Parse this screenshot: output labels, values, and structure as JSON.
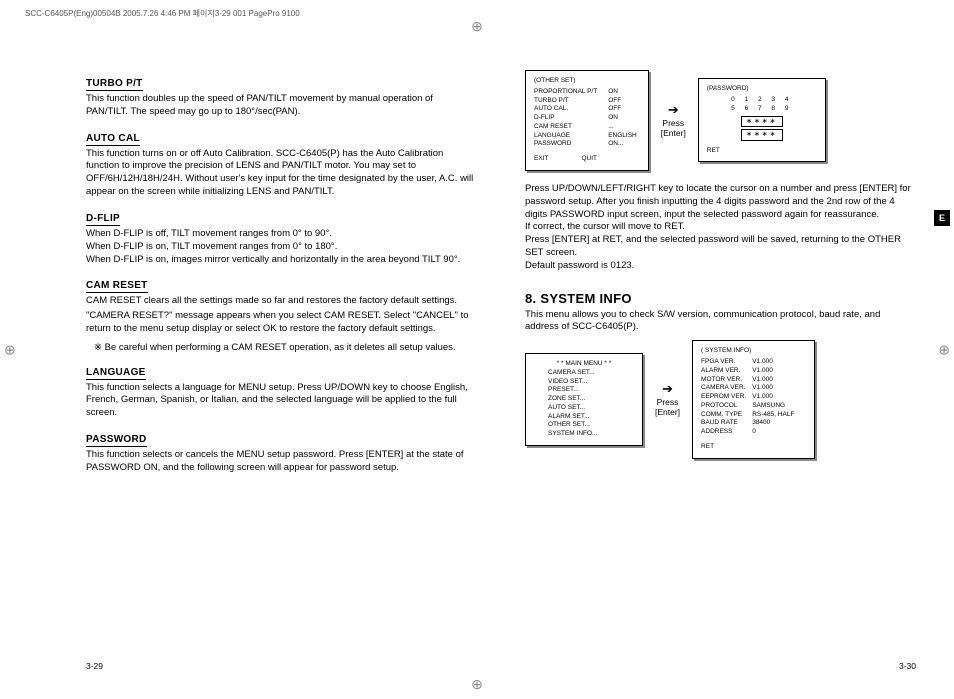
{
  "header": "SCC-C6405P(Eng)00504B  2005.7.26 4:46 PM  페이지3-29   001 PagePro 9100",
  "sideTab": "E",
  "pageLeft": "3-29",
  "pageRight": "3-30",
  "left": {
    "turbo": {
      "h": "TURBO P/T",
      "p": "This function doubles up the speed of PAN/TILT movement by manual operation of PAN/TILT. The speed may go up to 180°/sec(PAN)."
    },
    "autocal": {
      "h": "AUTO CAL",
      "p": "This function turns on or off Auto Calibration. SCC-C6405(P) has the Auto Calibration function to improve the precision of LENS and PAN/TILT motor. You may set to OFF/6H/12H/18H/24H. Without user's key input for the time designated by the user, A.C. will appear on the screen while initializing LENS and PAN/TILT."
    },
    "dflip": {
      "h": "D-FLIP",
      "l1": "When D-FLIP is off, TILT movement ranges from 0° to 90°.",
      "l2": "When D-FLIP is on, TILT movement ranges from 0° to 180°.",
      "l3": "When D-FLIP is on, images mirror vertically and horizontally in the area beyond TILT 90°."
    },
    "camreset": {
      "h": "CAM RESET",
      "p1": "CAM RESET clears all the settings made so far and restores the factory default settings.",
      "p2": "\"CAMERA RESET?\" message appears when you select CAM RESET. Select \"CANCEL\" to return to the menu setup display or select OK to restore the factory default settings.",
      "note": "※ Be careful when performing a CAM RESET operation, as it deletes all setup values."
    },
    "lang": {
      "h": "LANGUAGE",
      "p": "This function selects a language for MENU setup. Press UP/DOWN key to choose English, French, German, Spanish, or Italian, and the selected language will be applied to the full screen."
    },
    "pw": {
      "h": "PASSWORD",
      "p": "This function selects or cancels the MENU setup password. Press [ENTER] at the state of PASSWORD ON, and the following screen will appear for password setup."
    }
  },
  "right": {
    "osd1": {
      "title": "(OTHER SET)",
      "rows": [
        [
          "PROPORTIONAL P/T",
          "ON"
        ],
        [
          "TURBO P/T",
          "OFF"
        ],
        [
          "AUTO CAL.",
          "OFF"
        ],
        [
          "D-FLIP",
          "ON"
        ],
        [
          "CAM RESET",
          "..."
        ],
        [
          "LANGUAGE",
          "ENGLISH"
        ],
        [
          "PASSWORD",
          "ON..."
        ]
      ],
      "exit": [
        "EXIT",
        "QUIT"
      ]
    },
    "arrow1": {
      "sym": "➔",
      "l1": "Press",
      "l2": "[Enter]"
    },
    "osd2": {
      "title": "(PASSWORD)",
      "row1": "0  1  2  3  4",
      "row2": "5  6  7  8  9",
      "f1": "∗∗∗∗",
      "f2": "∗∗∗∗",
      "ret": "RET"
    },
    "pwtext": {
      "l1": "Press UP/DOWN/LEFT/RIGHT key to locate the cursor on a number and press [ENTER] for password setup. After you finish inputting the 4 digits password and the 2nd row of the 4 digits PASSWORD input screen, input the selected password again for reassurance.",
      "l2": "If correct, the cursor will move to RET.",
      "l3": "Press [ENTER] at RET, and the selected password will be saved, returning to the OTHER SET screen.",
      "l4": "Default password is 0123."
    },
    "sysinfo": {
      "h": "8. SYSTEM INFO",
      "p": "This menu allows you to check S/W version, communication protocol, baud rate, and address of SCC-C6405(P)."
    },
    "menu": {
      "title": "* *  MAIN MENU  * *",
      "items": [
        "CAMERA SET...",
        "VIDEO SET...",
        "PRESET...",
        "ZONE SET...",
        "AUTO SET...",
        "ALARM SET...",
        "OTHER SET...",
        "SYSTEM INFO..."
      ]
    },
    "arrow2": {
      "sym": "➔",
      "l1": "Press",
      "l2": "[Enter]"
    },
    "sys": {
      "title": "( SYSTEM INFO)",
      "rows": [
        [
          "FPGA VER.",
          "V1.000"
        ],
        [
          "ALARM VER.",
          "V1.000"
        ],
        [
          "MOTOR VER.",
          "V1.000"
        ],
        [
          "CAMERA VER.",
          "V1.000"
        ],
        [
          "EEPROM VER.",
          "V1.000"
        ],
        [
          "PROTOCOL",
          "SAMSUNG"
        ],
        [
          "COMM. TYPE",
          "RS-485, HALF"
        ],
        [
          "BAUD RATE",
          "38400"
        ],
        [
          "ADDRESS",
          "0"
        ]
      ],
      "ret": "RET"
    }
  }
}
